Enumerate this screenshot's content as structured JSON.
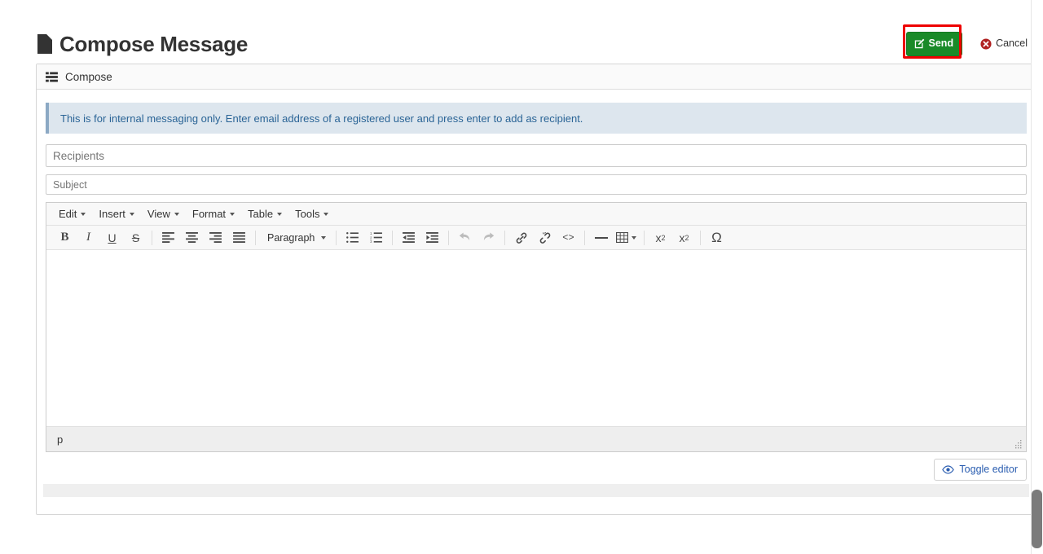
{
  "header": {
    "title": "Compose Message",
    "title_icon": "file-icon",
    "send_label": "Send",
    "send_icon": "pencil-square-icon",
    "send_color": "#1a8a28",
    "cancel_label": "Cancel",
    "cancel_icon": "times-circle-icon",
    "cancel_icon_color": "#b02020",
    "annotation_color": "#ee0000"
  },
  "panel": {
    "heading": "Compose",
    "heading_icon": "th-list-icon"
  },
  "alert": {
    "text": "This is for internal messaging only. Enter email address of a registered user and press enter to add as recipient.",
    "accent_color": "#8ca9c4",
    "background_color": "#dde6ee",
    "text_color": "#2a6496"
  },
  "form": {
    "recipients": {
      "value": "",
      "placeholder": "Recipients"
    },
    "subject": {
      "value": "",
      "placeholder": "Subject"
    }
  },
  "editor": {
    "menubar": [
      {
        "label": "Edit",
        "name": "menu-edit"
      },
      {
        "label": "Insert",
        "name": "menu-insert"
      },
      {
        "label": "View",
        "name": "menu-view"
      },
      {
        "label": "Format",
        "name": "menu-format"
      },
      {
        "label": "Table",
        "name": "menu-table"
      },
      {
        "label": "Tools",
        "name": "menu-tools"
      }
    ],
    "format_select": "Paragraph",
    "toolbar": [
      {
        "name": "bold-icon",
        "glyph": "B"
      },
      {
        "name": "italic-icon",
        "glyph": "I"
      },
      {
        "name": "underline-icon",
        "glyph": "U"
      },
      {
        "name": "strikethrough-icon",
        "glyph": "S"
      },
      {
        "name": "align-left-icon",
        "glyph": ""
      },
      {
        "name": "align-center-icon",
        "glyph": ""
      },
      {
        "name": "align-right-icon",
        "glyph": ""
      },
      {
        "name": "align-justify-icon",
        "glyph": ""
      },
      {
        "name": "bullist-icon",
        "glyph": ""
      },
      {
        "name": "numlist-icon",
        "glyph": ""
      },
      {
        "name": "outdent-icon",
        "glyph": ""
      },
      {
        "name": "indent-icon",
        "glyph": ""
      },
      {
        "name": "undo-icon",
        "glyph": ""
      },
      {
        "name": "redo-icon",
        "glyph": ""
      },
      {
        "name": "link-icon",
        "glyph": ""
      },
      {
        "name": "unlink-icon",
        "glyph": ""
      },
      {
        "name": "source-code-icon",
        "glyph": "<>"
      },
      {
        "name": "horizontal-rule-icon",
        "glyph": ""
      },
      {
        "name": "table-icon",
        "glyph": ""
      },
      {
        "name": "subscript-icon",
        "glyph": "x"
      },
      {
        "name": "superscript-icon",
        "glyph": "x"
      },
      {
        "name": "special-character-icon",
        "glyph": "Ω"
      }
    ],
    "content": "",
    "statusbar_path": "p"
  },
  "toggle": {
    "label": "Toggle editor",
    "icon": "eye-icon",
    "icon_color": "#2a5db0"
  }
}
